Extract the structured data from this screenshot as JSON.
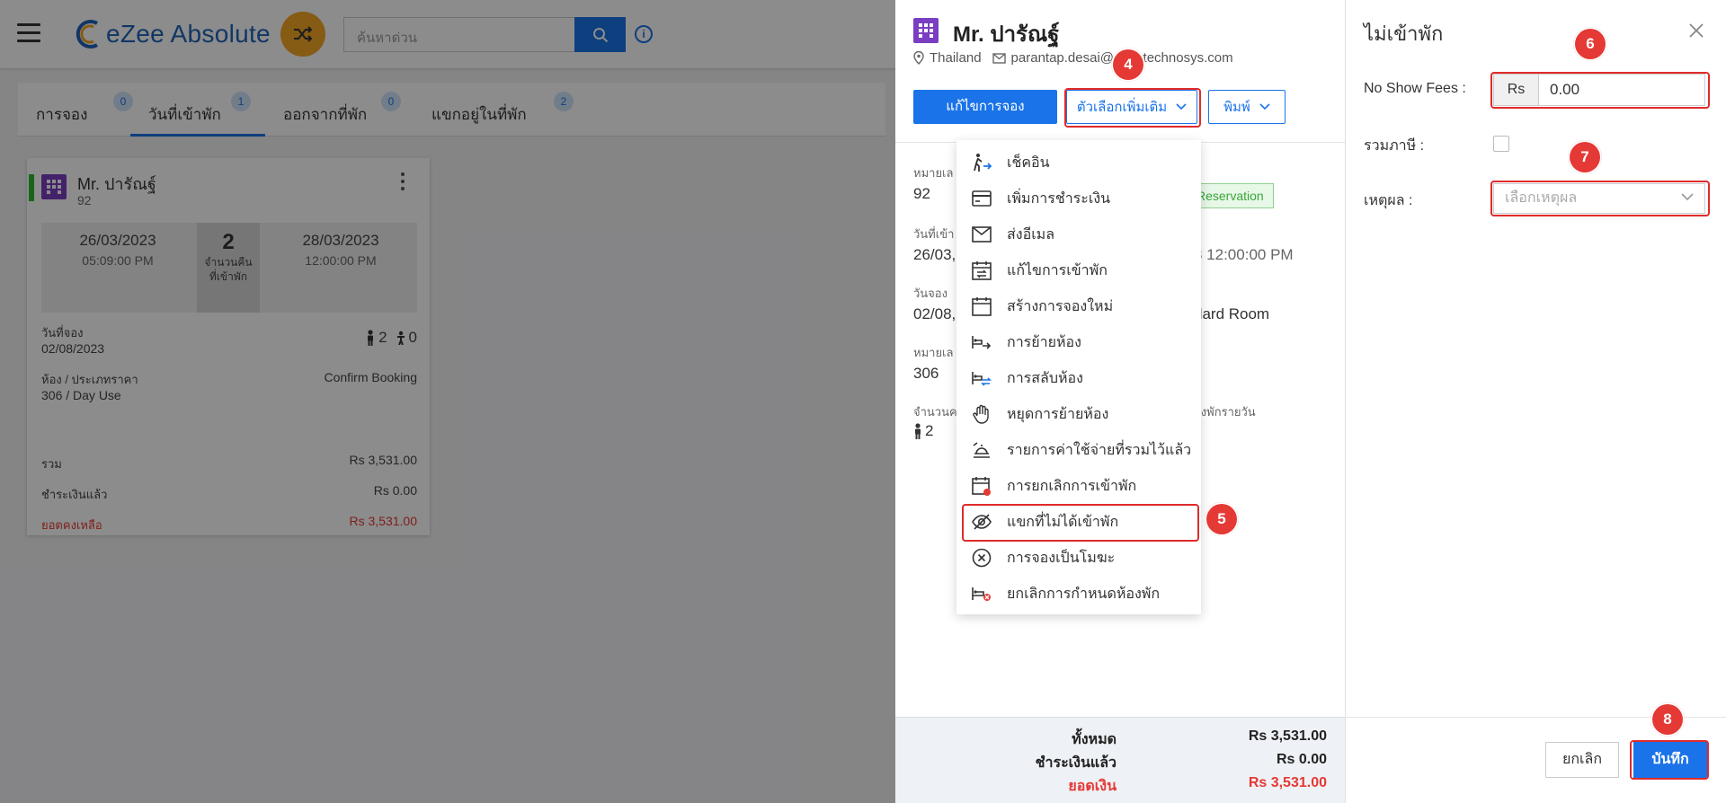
{
  "app": {
    "logo_text": "eZee Absolute",
    "search_placeholder": "ค้นหาด่วน"
  },
  "tabs": [
    {
      "label": "การจอง",
      "count": "0"
    },
    {
      "label": "วันที่เข้าพัก",
      "count": "1"
    },
    {
      "label": "ออกจากที่พัก",
      "count": "0"
    },
    {
      "label": "แขกอยู่ในที่พัก",
      "count": "2"
    }
  ],
  "card": {
    "guest_name": "Mr. ปารัณฐ์",
    "booking_no": "92",
    "arrival_date": "26/03/2023",
    "arrival_time": "05:09:00 PM",
    "nights": "2",
    "nights_label": "จำนวนคืนที่เข้าพัก",
    "departure_date": "28/03/2023",
    "departure_time": "12:00:00 PM",
    "booking_date_label": "วันที่จอง",
    "booking_date": "02/08/2023",
    "adults": "2",
    "children": "0",
    "room_label": "ห้อง / ประเภทราคา",
    "room_value": "306 / Day Use",
    "status": "Confirm Booking",
    "total_label": "รวม",
    "total_value": "Rs 3,531.00",
    "paid_label": "ชำระเงินแล้ว",
    "paid_value": "Rs 0.00",
    "balance_label": "ยอดคงเหลือ",
    "balance_value": "Rs 3,531.00"
  },
  "detail": {
    "guest_name": "Mr. ปารัณฐ์",
    "country": "Thailand",
    "email": "parantap.desai@ezeetechnosys.com",
    "edit_button": "แก้ไขการจอง",
    "more_button": "ตัวเลือกเพิ่มเติม",
    "print_button": "พิมพ์",
    "label_booking_no": "หมายเล",
    "booking_no": "92",
    "badge": "Reservation",
    "label_arrival": "วันที่เข้า",
    "arrival": "26/03,",
    "departure_tail": "3 12:00:00 PM",
    "label_booking_date": "วันจอง",
    "booking_date": "02/08,",
    "room_type_tail": "dard Room",
    "label_room_no": "หมายเล",
    "room_no": "306",
    "label_guests": "จำนวนค",
    "rate_tail": "องพักรายวัน",
    "adults": "2",
    "total_label": "ทั้งหมด",
    "total_value": "Rs 3,531.00",
    "paid_label": "ชำระเงินแล้ว",
    "paid_value": "Rs 0.00",
    "balance_label": "ยอดเงิน",
    "balance_value": "Rs 3,531.00"
  },
  "menu": [
    {
      "label": "เช็คอิน",
      "icon": "checkin-icon"
    },
    {
      "label": "เพิ่มการชำระเงิน",
      "icon": "card-icon"
    },
    {
      "label": "ส่งอีเมล",
      "icon": "mail-icon"
    },
    {
      "label": "แก้ไขการเข้าพัก",
      "icon": "edit-stay-icon"
    },
    {
      "label": "สร้างการจองใหม่",
      "icon": "calendar-icon"
    },
    {
      "label": "การย้ายห้อง",
      "icon": "room-move-icon"
    },
    {
      "label": "การสลับห้อง",
      "icon": "room-swap-icon"
    },
    {
      "label": "หยุดการย้ายห้อง",
      "icon": "hand-stop-icon"
    },
    {
      "label": "รายการค่าใช้จ่ายที่รวมไว้แล้ว",
      "icon": "inclusion-icon"
    },
    {
      "label": "การยกเลิกการเข้าพัก",
      "icon": "cancel-calendar-icon"
    },
    {
      "label": "แขกที่ไม่ได้เข้าพัก",
      "icon": "eye-off-icon"
    },
    {
      "label": "การจองเป็นโมฆะ",
      "icon": "void-icon"
    },
    {
      "label": "ยกเลิกการกำหนดห้องพัก",
      "icon": "unassign-room-icon"
    }
  ],
  "noshow": {
    "title": "ไม่เข้าพัก",
    "fees_label": "No Show Fees :",
    "currency": "Rs",
    "fees_value": "0.00",
    "tax_label": "รวมภาษี :",
    "reason_label": "เหตุผล :",
    "reason_placeholder": "เลือกเหตุผล",
    "cancel_button": "ยกเลิก",
    "save_button": "บันทึก"
  },
  "steps": [
    "4",
    "5",
    "6",
    "7",
    "8"
  ],
  "colors": {
    "accent": "#1a73e8",
    "annotation": "#e53935",
    "balance": "#e53935",
    "badge_green": "#3aa63a"
  }
}
